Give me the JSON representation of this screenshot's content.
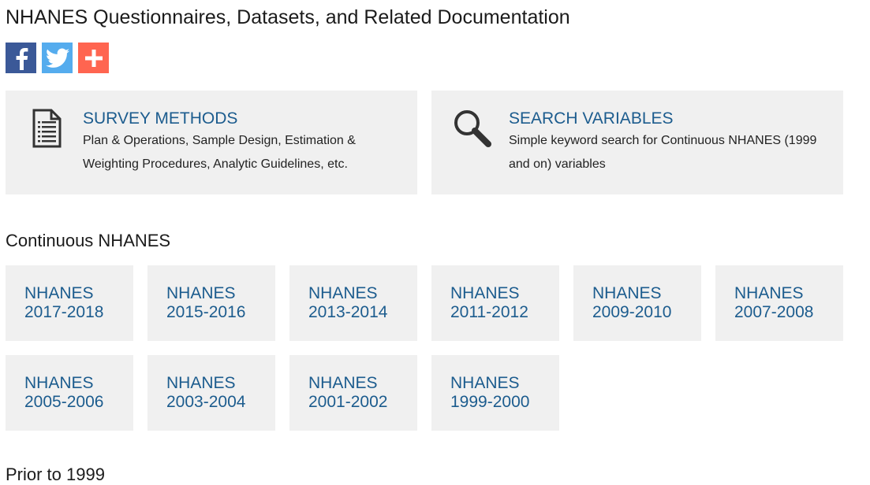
{
  "page": {
    "title": "NHANES Questionnaires, Datasets, and Related Documentation"
  },
  "share": [
    {
      "icon": "facebook-icon",
      "color": "#3b5998"
    },
    {
      "icon": "twitter-icon",
      "color": "#55acee"
    },
    {
      "icon": "plus-icon",
      "color": "#ff6550"
    }
  ],
  "features": {
    "methods": {
      "title": "SURVEY METHODS",
      "description": "Plan & Operations, Sample Design, Estimation & Weighting Procedures, Analytic Guidelines, etc.",
      "icon": "document-icon"
    },
    "search": {
      "title": "SEARCH VARIABLES",
      "description": "Simple keyword search for Continuous NHANES (1999 and on) variables",
      "icon": "magnifier-icon"
    }
  },
  "continuous": {
    "heading": "Continuous NHANES",
    "cycles": [
      {
        "line1": "NHANES",
        "line2": "2017-2018"
      },
      {
        "line1": "NHANES",
        "line2": "2015-2016"
      },
      {
        "line1": "NHANES",
        "line2": "2013-2014"
      },
      {
        "line1": "NHANES",
        "line2": "2011-2012"
      },
      {
        "line1": "NHANES",
        "line2": "2009-2010"
      },
      {
        "line1": "NHANES",
        "line2": "2007-2008"
      },
      {
        "line1": "NHANES",
        "line2": "2005-2006"
      },
      {
        "line1": "NHANES",
        "line2": "2003-2004"
      },
      {
        "line1": "NHANES",
        "line2": "2001-2002"
      },
      {
        "line1": "NHANES",
        "line2": "1999-2000"
      }
    ]
  },
  "prior": {
    "heading": "Prior to 1999"
  },
  "colors": {
    "link": "#1c5c8e",
    "tile": "#f0f0f0",
    "facebook": "#3b5998",
    "twitter": "#55acee",
    "addthis": "#ff6550"
  }
}
